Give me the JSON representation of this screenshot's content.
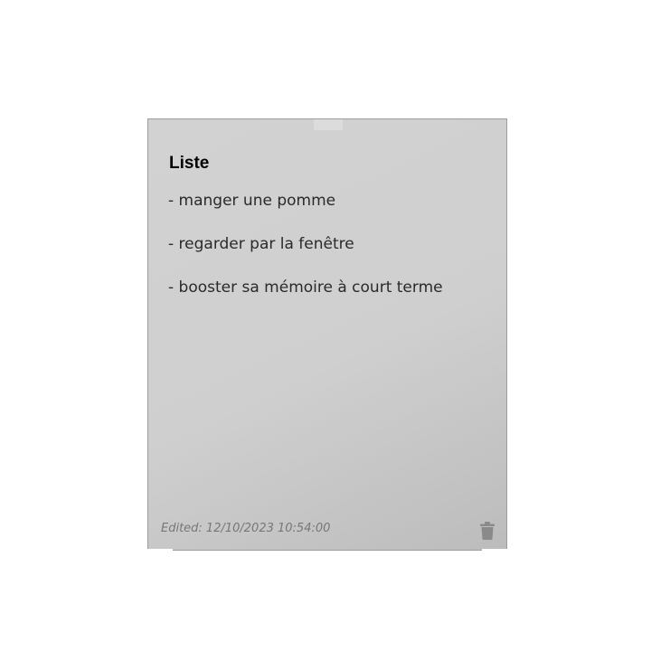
{
  "note": {
    "title": "Liste",
    "items": [
      "- manger une pomme",
      "- regarder par la fenêtre",
      "- booster sa mémoire à court terme"
    ],
    "edited": "Edited: 12/10/2023 10:54:00",
    "delete_icon": "trash-icon"
  },
  "colors": {
    "note_background": "#cfcfcf",
    "border": "#9c9c9c",
    "icon": "#8a8a8a"
  }
}
